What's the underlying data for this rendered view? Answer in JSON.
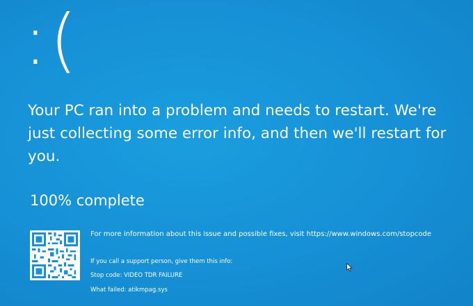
{
  "screen": {
    "background_color": "#1690d6",
    "text_color": "#ffffff"
  },
  "face": {
    "text": ":("
  },
  "message": {
    "text": "Your PC ran into a problem and needs to restart. We're just collecting some error info, and then we'll restart for you."
  },
  "progress": {
    "percent": 100,
    "text": "100% complete"
  },
  "qr_code": {
    "icon": "qr-code-icon"
  },
  "info": {
    "more_info": "For more information about this issue and possible fixes, visit https://www.windows.com/stopcode",
    "support_prompt": "If you call a support person, give them this info:",
    "stop_code": "Stop code: VIDEO TDR FAILURE",
    "what_failed": "What failed: atikmpag.sys"
  },
  "cursor": {
    "icon": "mouse-pointer-icon"
  }
}
